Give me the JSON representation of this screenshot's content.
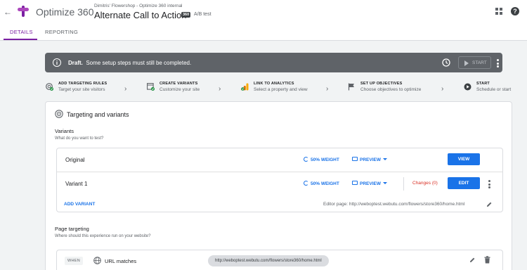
{
  "header": {
    "app_name": "Optimize 360",
    "breadcrumb": "Dimitris' Flowershop - Optimize 360 internal",
    "experience_title": "Alternate Call to Action",
    "badge": "360",
    "experience_type": "A/B test",
    "brand_color": "#7b1fa2"
  },
  "tabs": [
    {
      "label": "DETAILS",
      "active": true
    },
    {
      "label": "REPORTING",
      "active": false
    }
  ],
  "status_banner": {
    "status": "Draft.",
    "message": "Some setup steps must still be completed.",
    "start_label": "START"
  },
  "steps": [
    {
      "title": "ADD TARGETING RULES",
      "subtitle": "Target your site visitors",
      "icon": "targeting-check-icon"
    },
    {
      "title": "CREATE VARIANTS",
      "subtitle": "Customize your site",
      "icon": "variants-check-icon"
    },
    {
      "title": "LINK TO ANALYTICS",
      "subtitle": "Select a property and view",
      "icon": "analytics-icon"
    },
    {
      "title": "SET UP OBJECTIVES",
      "subtitle": "Choose objectives to optimize",
      "icon": "flag-icon"
    },
    {
      "title": "START",
      "subtitle": "Schedule or start",
      "icon": "play-icon"
    }
  ],
  "card": {
    "title": "Targeting and variants",
    "variants_section": {
      "title": "Variants",
      "subtitle": "What do you want to test?",
      "rows": [
        {
          "name": "Original",
          "weight": "50% WEIGHT",
          "preview": "PREVIEW",
          "changes": "",
          "action": "VIEW"
        },
        {
          "name": "Variant 1",
          "weight": "50% WEIGHT",
          "preview": "PREVIEW",
          "changes": "Changes (0)",
          "action": "EDIT"
        }
      ],
      "add_variant": "ADD VARIANT",
      "editor_page": "Editor page: http://weboptest.webutu.com/flowers/store360/home.html"
    },
    "page_targeting": {
      "title": "Page targeting",
      "subtitle": "Where should this experience run on your website?",
      "when_label": "WHEN",
      "condition": "URL matches",
      "url": "http://weboptest.webutu.com/flowers/store360/home.html"
    }
  }
}
